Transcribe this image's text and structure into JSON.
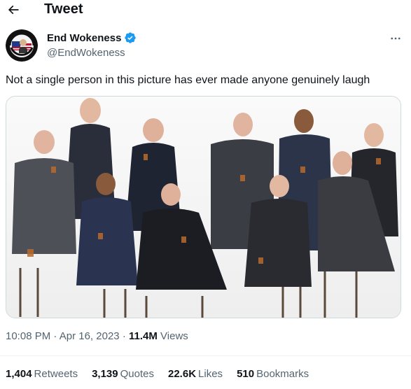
{
  "header": {
    "title": "Tweet"
  },
  "author": {
    "display_name": "End Wokeness",
    "handle": "@EndWokeness",
    "verified": true,
    "verified_color": "#1d9bf0"
  },
  "tweet": {
    "text": "Not a single person in this picture has ever made anyone genuinely laugh",
    "time": "10:08 PM",
    "date": "Apr 16, 2023",
    "views_count": "11.4M",
    "views_label": "Views"
  },
  "stats": [
    {
      "value": "1,404",
      "label": "Retweets"
    },
    {
      "value": "3,139",
      "label": "Quotes"
    },
    {
      "value": "22.6K",
      "label": "Likes"
    },
    {
      "value": "510",
      "label": "Bookmarks"
    }
  ],
  "icons": {
    "back": "arrow-left-icon",
    "verified": "verified-badge-icon",
    "more": "more-horizontal-icon"
  },
  "colors": {
    "text_primary": "#0f1419",
    "text_secondary": "#536471",
    "accent": "#1d9bf0",
    "border": "#cfd9de"
  }
}
